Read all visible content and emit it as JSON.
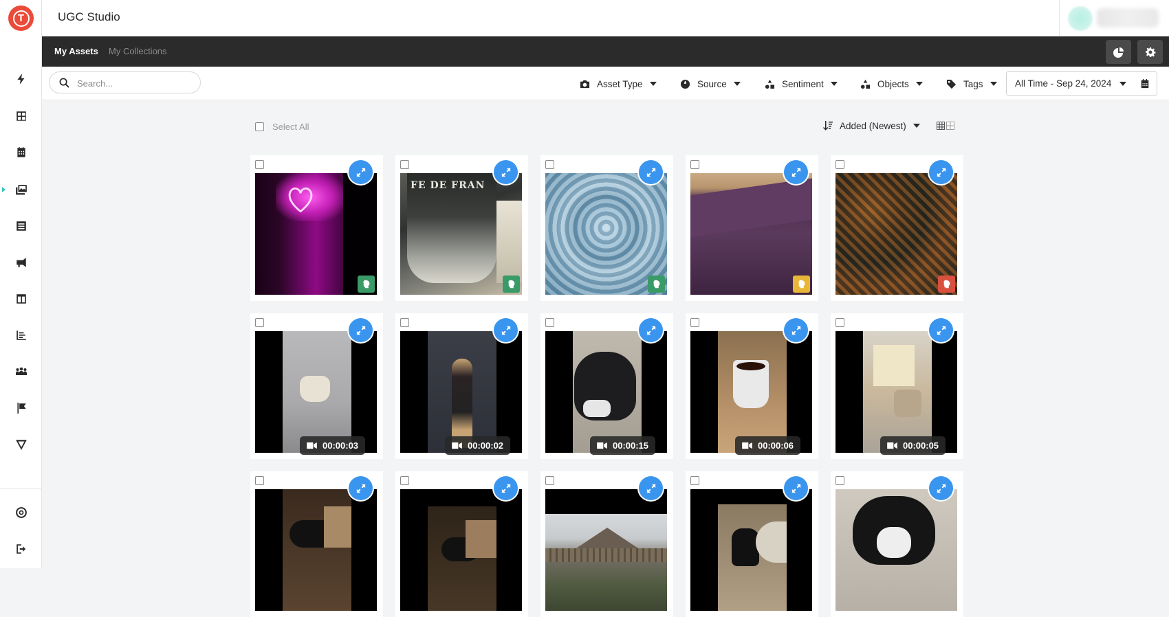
{
  "app": {
    "logo_letter": "T",
    "title": "UGC Studio"
  },
  "sidebar": {
    "items": [
      {
        "name": "lightning-icon"
      },
      {
        "name": "dashboard-grid-icon"
      },
      {
        "name": "calendar-icon"
      },
      {
        "name": "media-library-icon",
        "active": true
      },
      {
        "name": "list-icon"
      },
      {
        "name": "megaphone-icon"
      },
      {
        "name": "layout-columns-icon"
      },
      {
        "name": "bar-chart-icon"
      },
      {
        "name": "people-icon"
      },
      {
        "name": "flag-icon"
      },
      {
        "name": "v-brand-icon"
      }
    ],
    "bottom_items": [
      {
        "name": "help-lifebuoy-icon"
      },
      {
        "name": "logout-icon"
      }
    ]
  },
  "tabs": {
    "my_assets": "My Assets",
    "my_collections": "My Collections"
  },
  "toolbar_buttons": [
    "pie-chart-icon",
    "gear-icon"
  ],
  "search": {
    "placeholder": "Search...",
    "value": ""
  },
  "filters": {
    "asset_type": "Asset Type",
    "source": "Source",
    "sentiment": "Sentiment",
    "objects": "Objects",
    "tags": "Tags",
    "date_range": "All Time - Sep 24, 2024"
  },
  "content": {
    "select_all": "Select All",
    "sort": "Added (Newest)"
  },
  "colors": {
    "accent_blue": "#3a95ee",
    "sentiment_positive": "#3a9a68",
    "sentiment_neutral": "#e8b739",
    "sentiment_negative": "#d9503e",
    "logo_red": "#ea4b3a"
  },
  "assets": {
    "row1": [
      {
        "type": "image",
        "subject": "neon heart",
        "sentiment": "positive"
      },
      {
        "type": "image",
        "subject": "mug",
        "sentiment": "positive"
      },
      {
        "type": "image",
        "subject": "knit texture",
        "sentiment": "positive"
      },
      {
        "type": "image",
        "subject": "purple rug",
        "sentiment": "neutral"
      },
      {
        "type": "image",
        "subject": "aerial forest",
        "sentiment": "negative"
      }
    ],
    "row2": [
      {
        "type": "video",
        "duration": "00:00:03"
      },
      {
        "type": "video",
        "duration": "00:00:02"
      },
      {
        "type": "video",
        "duration": "00:00:15"
      },
      {
        "type": "video",
        "duration": "00:00:06"
      },
      {
        "type": "video",
        "duration": "00:00:05"
      }
    ],
    "row3": [
      {
        "type": "video"
      },
      {
        "type": "video"
      },
      {
        "type": "image"
      },
      {
        "type": "video"
      },
      {
        "type": "image"
      }
    ]
  }
}
